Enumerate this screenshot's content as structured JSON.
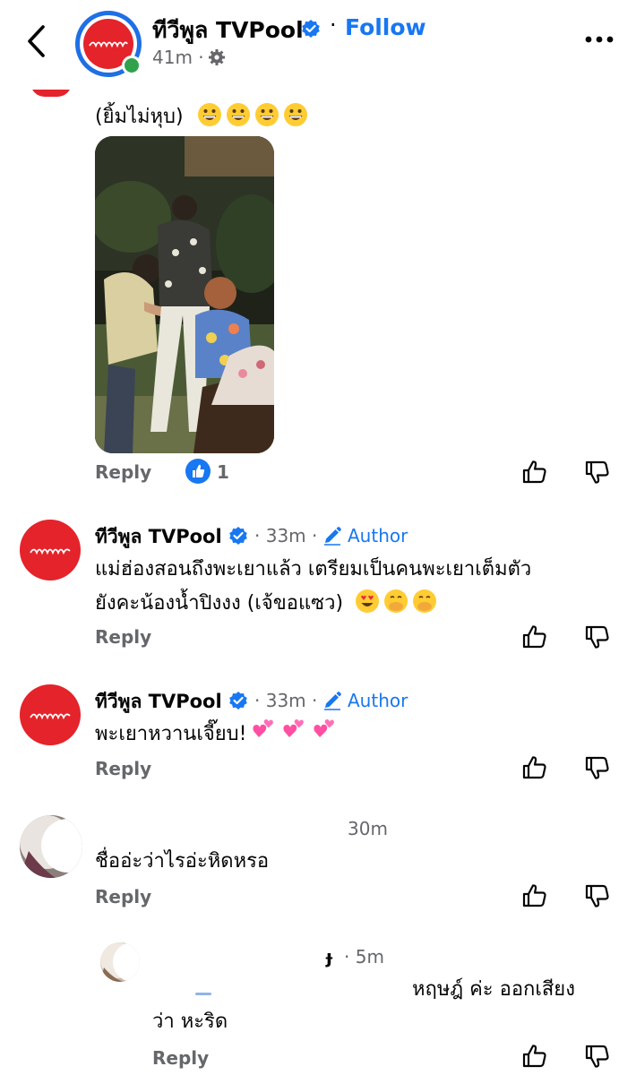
{
  "header": {
    "page_name": "ทีวีพูล TVPool",
    "separator": "·",
    "follow_label": "Follow",
    "time": "41m ·"
  },
  "comments": [
    {
      "text_lines": [
        "(ยิ้มไม่หุบ)"
      ],
      "emoji": "grinning-face x4",
      "reply_label": "Reply",
      "like_count": "1"
    },
    {
      "name": "ทีวีพูล TVPool",
      "time": "· 33m ·",
      "badge": "Author",
      "text_lines": [
        "แม่ฮ่องสอนถึงพะเยาแล้ว เตรียมเป็นคนพะเยาเต็มตัว",
        "ยังคะน้องน้ำปิงงง (เจ้ขอแซว)"
      ],
      "reply_label": "Reply"
    },
    {
      "name": "ทีวีพูล TVPool",
      "time": "· 33m ·",
      "badge": "Author",
      "text_lines": [
        "พะเยาหวานเจี๊ยบ!"
      ],
      "reply_label": "Reply"
    },
    {
      "time": "30m",
      "text_lines": [
        "ชื่ออ่ะว่าไรอ่ะหิดหรอ"
      ],
      "reply_label": "Reply"
    },
    {
      "name_fragment": "ɟ",
      "time": "· 5m",
      "text_lines": [
        "หฤษฎ์ ค่ะ ออกเสียง",
        "ว่า หะริด"
      ],
      "reply_label": "Reply"
    }
  ],
  "colors": {
    "brand_red": "#e4232a",
    "facebook_blue": "#1877f2",
    "secondary_text": "#65676b",
    "online_green": "#31a24c"
  }
}
